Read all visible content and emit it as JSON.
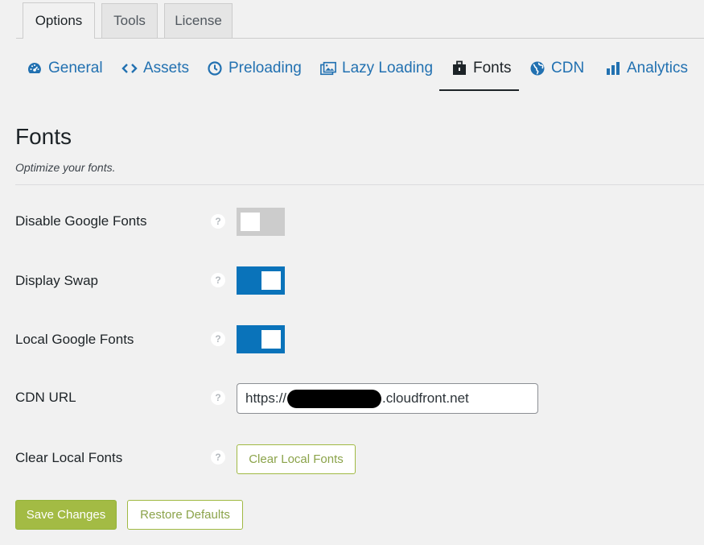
{
  "top_tabs": [
    {
      "label": "Options",
      "active": true
    },
    {
      "label": "Tools",
      "active": false
    },
    {
      "label": "License",
      "active": false
    }
  ],
  "sub_nav": [
    {
      "label": "General",
      "icon": "dashboard-icon",
      "active": false
    },
    {
      "label": "Assets",
      "icon": "code-brackets-icon",
      "active": false
    },
    {
      "label": "Preloading",
      "icon": "clock-icon",
      "active": false
    },
    {
      "label": "Lazy Loading",
      "icon": "images-icon",
      "active": false
    },
    {
      "label": "Fonts",
      "icon": "briefcase-icon",
      "active": true
    },
    {
      "label": "CDN",
      "icon": "globe-icon",
      "active": false
    },
    {
      "label": "Analytics",
      "icon": "bar-chart-icon",
      "active": false
    }
  ],
  "section": {
    "title": "Fonts",
    "description": "Optimize your fonts."
  },
  "settings": {
    "disable_google_fonts": {
      "label": "Disable Google Fonts",
      "enabled": false
    },
    "display_swap": {
      "label": "Display Swap",
      "enabled": true
    },
    "local_google_fonts": {
      "label": "Local Google Fonts",
      "enabled": true
    },
    "cdn_url": {
      "label": "CDN URL",
      "value_prefix": "https://",
      "value_suffix": ".cloudfront.net"
    },
    "clear_local_fonts": {
      "label": "Clear Local Fonts",
      "button_label": "Clear Local Fonts"
    }
  },
  "help_glyph": "?",
  "actions": {
    "save_label": "Save Changes",
    "restore_label": "Restore Defaults"
  },
  "colors": {
    "link_blue": "#2271b1",
    "toggle_on": "#0a73ba",
    "toggle_off": "#cccccc",
    "accent_green": "#a3bb44"
  }
}
